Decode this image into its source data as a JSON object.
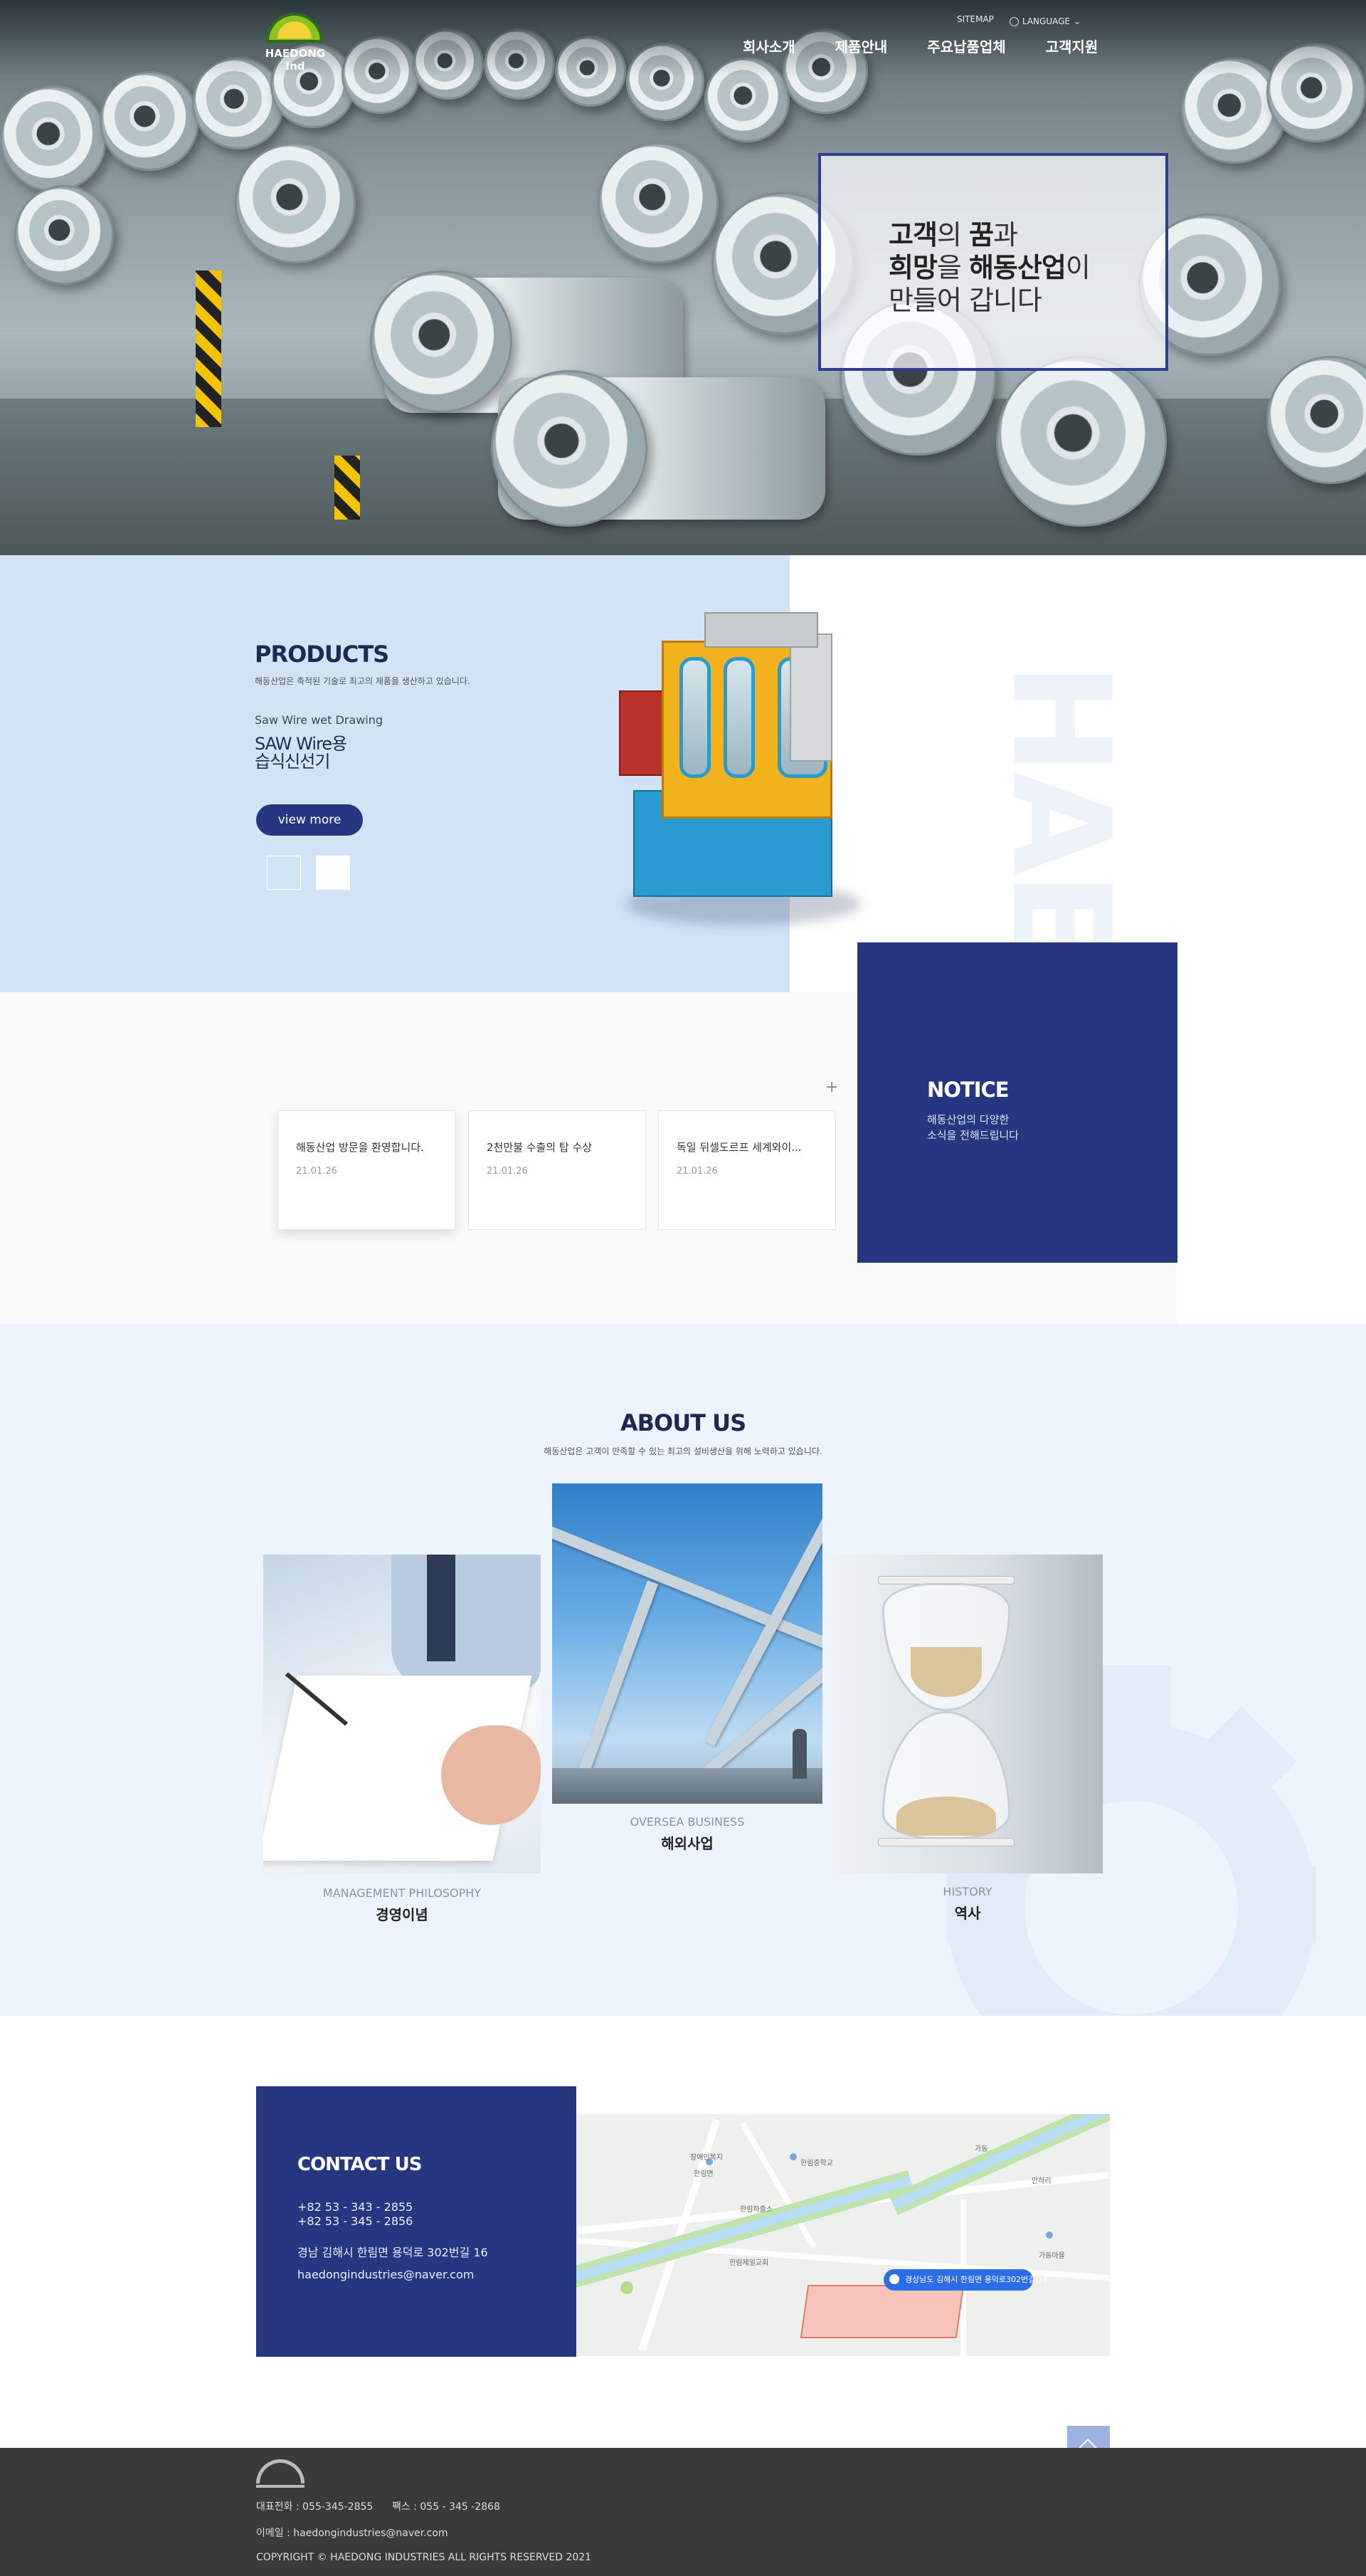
{
  "header": {
    "logo_text": "HAEDONG Ind",
    "utility": {
      "sitemap": "SITEMAP",
      "language": "LANGUAGE"
    },
    "nav": [
      "회사소개",
      "제품안내",
      "주요납품업체",
      "고객지원"
    ]
  },
  "hero": {
    "line1_a": "고객",
    "line1_b": "의 ",
    "line1_c": "꿈",
    "line1_d": "과",
    "line2_a": "희망",
    "line2_b": "을 ",
    "line2_c": "해동산업",
    "line2_d": "이",
    "line3": "만들어 갑니다"
  },
  "products": {
    "title": "PRODUCTS",
    "subtitle": "해동산업은 축적된 기술로 최고의 제품을 생산하고 있습니다.",
    "category": "Saw Wire wet Drawing",
    "name_line1": "SAW Wire용",
    "name_line2": "습식신선기",
    "view_more": "view more",
    "watermark": "HAE"
  },
  "notice": {
    "title": "NOTICE",
    "sub1": "해동산업의 다양한",
    "sub2": "소식을 전해드립니다",
    "more": "+",
    "items": [
      {
        "title": "해동산업 방문을 환영합니다.",
        "date": "21.01.26"
      },
      {
        "title": "2천만불 수출의 탑 수상",
        "date": "21.01.26"
      },
      {
        "title": "독일 뒤셀도르프 세계와이...",
        "date": "21.01.26"
      }
    ]
  },
  "about": {
    "title": "ABOUT US",
    "subtitle": "해동산업은 고객이 만족할 수 있는 최고의 설비생산을 위해 노력하고 있습니다.",
    "items": [
      {
        "en": "MANAGEMENT PHILOSOPHY",
        "ko": "경영이념"
      },
      {
        "en": "OVERSEA BUSINESS",
        "ko": "해외사업"
      },
      {
        "en": "HISTORY",
        "ko": "역사"
      }
    ]
  },
  "contact": {
    "title": "CONTACT US",
    "tel": "+82 53 - 343 - 2855",
    "fax": "+82 53 - 345 - 2856",
    "address": "경남 김해시 한림면 용덕로 302번길 16",
    "email": "haedongindustries@naver.com",
    "map_pin": "경상남도 김해시 한림면 용덕로302번길 16",
    "map_labels": [
      "장애인복지",
      "한림면",
      "한림중학교",
      "가동",
      "안하리",
      "한림파출소",
      "한림제일교회",
      "가동마을"
    ]
  },
  "footer": {
    "phone_line": "대표전화 : 055-345-2855      팩스 : 055 - 345 -2868",
    "email_line": "이메일 : haedongindustries@naver.com",
    "copyright": "COPYRIGHT © HAEDONG INDUSTRIES ALL RIGHTS RESERVED 2021"
  },
  "colors": {
    "brand_navy": "#263680",
    "products_bg": "#d2e3f6",
    "about_bg": "#edf4fd",
    "footer_bg": "#3a3a3a"
  },
  "icons": [
    "globe-icon",
    "chevron-down-icon",
    "plus-icon",
    "arrow-up-icon",
    "map-pin-icon"
  ]
}
